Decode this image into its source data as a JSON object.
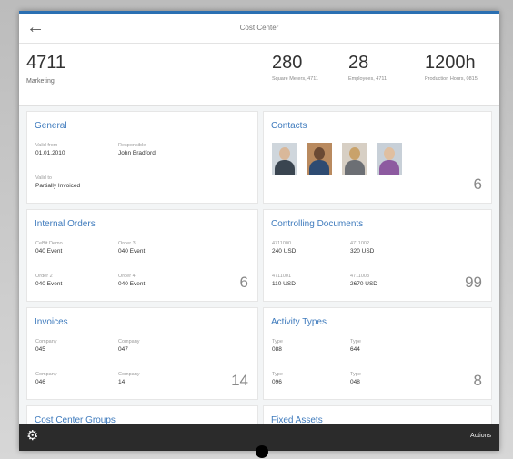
{
  "app": {
    "title": "Cost Center"
  },
  "header": {
    "id": "4711",
    "subtitle": "Marketing",
    "kpis": [
      {
        "value": "280",
        "label": "Square Meters, 4711"
      },
      {
        "value": "28",
        "label": "Employees, 4711"
      },
      {
        "value": "1200h",
        "label": "Production Hours, 0815"
      }
    ]
  },
  "tiles": {
    "general": {
      "title": "General",
      "valid_from_label": "Valid from",
      "valid_from": "01.01.2010",
      "responsible_label": "Responsible",
      "responsible": "John Bradford",
      "valid_to_label": "Valid to",
      "valid_to": "Partially Invoiced"
    },
    "contacts": {
      "title": "Contacts",
      "count": "6"
    },
    "internal_orders": {
      "title": "Internal Orders",
      "items": [
        {
          "label": "CeBit Demo",
          "value": "040 Event"
        },
        {
          "label": "Order 3",
          "value": "040 Event"
        },
        {
          "label": "Order 2",
          "value": "040 Event"
        },
        {
          "label": "Order 4",
          "value": "040 Event"
        }
      ],
      "count": "6"
    },
    "controlling_documents": {
      "title": "Controlling Documents",
      "items": [
        {
          "label": "4711000",
          "value": "240 USD"
        },
        {
          "label": "4711002",
          "value": "320 USD"
        },
        {
          "label": "4711001",
          "value": "110 USD"
        },
        {
          "label": "4711003",
          "value": "2670 USD"
        }
      ],
      "count": "99"
    },
    "invoices": {
      "title": "Invoices",
      "items": [
        {
          "label": "Company",
          "value": "045"
        },
        {
          "label": "Company",
          "value": "047"
        },
        {
          "label": "Company",
          "value": "046"
        },
        {
          "label": "Company",
          "value": "14"
        }
      ],
      "count": "14"
    },
    "activity_types": {
      "title": "Activity Types",
      "items": [
        {
          "label": "Type",
          "value": "088"
        },
        {
          "label": "Type",
          "value": "644"
        },
        {
          "label": "Type",
          "value": "096"
        },
        {
          "label": "Type",
          "value": "048"
        }
      ],
      "count": "8"
    },
    "cost_center_groups": {
      "title": "Cost Center Groups"
    },
    "fixed_assets": {
      "title": "Fixed Assets"
    }
  },
  "footer": {
    "actions_label": "Actions"
  },
  "icons": {
    "back": "back-arrow-icon",
    "settings": "gear-icon"
  },
  "colors": {
    "accent": "#3f7bbd",
    "topbar_line": "#2a6fb2",
    "footer": "#2b2b2b"
  }
}
